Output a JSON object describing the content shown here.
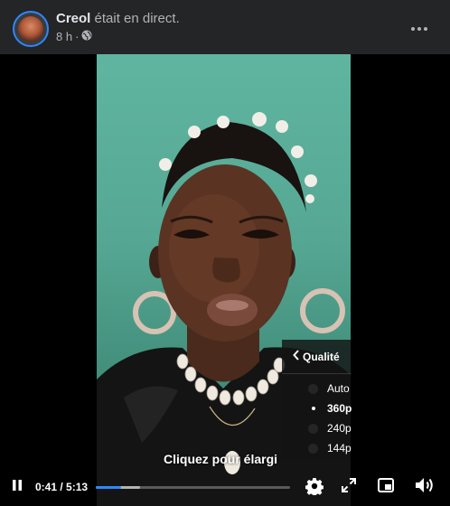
{
  "post": {
    "author_name": "Creol",
    "author_action": "était en direct.",
    "timestamp": "8 h",
    "separator": "·",
    "audience_icon": "globe-icon",
    "more_icon": "more-horizontal-icon"
  },
  "video": {
    "caption": "Cliquez pour élargi",
    "current_time": "0:41",
    "duration": "5:13",
    "time_separator": " / ",
    "played_fraction": 0.131,
    "buffered_fraction": 0.23,
    "controls": {
      "play_pause_icon": "pause-icon",
      "settings_icon": "gear-icon",
      "fullscreen_icon": "expand-icon",
      "pip_icon": "picture-in-picture-icon",
      "volume_icon": "volume-icon"
    }
  },
  "quality_menu": {
    "title": "Qualité",
    "options": [
      {
        "label": "Auto",
        "selected": false
      },
      {
        "label": "360p",
        "selected": true
      },
      {
        "label": "240p",
        "selected": false
      },
      {
        "label": "144p",
        "selected": false
      }
    ]
  },
  "colors": {
    "accent": "#2d88ff",
    "background": "#242526",
    "video_background": "#000000"
  }
}
